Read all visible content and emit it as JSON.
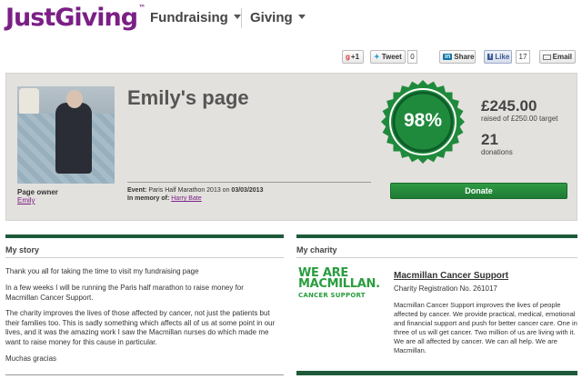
{
  "header": {
    "logo": "JustGiving",
    "logo_tm": "™",
    "nav": [
      {
        "label": "Fundraising"
      },
      {
        "label": "Giving"
      }
    ]
  },
  "share": {
    "gplus_label": "+1",
    "tweet_label": "Tweet",
    "tweet_count": "0",
    "linkedin_label": "Share",
    "fb_label": "Like",
    "fb_count": "17",
    "email_label": "Email"
  },
  "summary": {
    "title": "Emily's page",
    "owner_label": "Page owner",
    "owner_name": "Emily",
    "event_prefix": "Event:",
    "event_text": "Paris Half Marathon 2013 on",
    "event_date": "03/03/2013",
    "memory_prefix": "In memory of:",
    "memory_name": "Harry Bate",
    "percent": "98%",
    "percent_value": 98,
    "amount_raised": "£245.00",
    "target_text": "raised of £250.00 target",
    "donations_count": "21",
    "donations_label": "donations",
    "donate_label": "Donate"
  },
  "story": {
    "heading": "My story",
    "paragraphs": [
      "Thank you all for taking the time to visit my fundraising page",
      "In a few weeks I will be running the Paris half marathon to raise money for Macmillan Cancer Support.",
      "The charity improves the lives of those affected by cancer, not just the patients but their families too. This is sadly something which affects all of us at some point in our lives, and it was the amazing work I saw the Macmillan nurses do which made me want to raise money for this cause in particular.",
      "Muchas gracias"
    ]
  },
  "charity": {
    "heading": "My charity",
    "logo_line1": "WE ARE",
    "logo_line2": "MACMILLAN.",
    "logo_line3": "CANCER SUPPORT",
    "name": "Macmillan Cancer Support",
    "registration": "Charity Registration No. 261017",
    "description": "Macmillan Cancer Support improves the lives of people affected by cancer. We provide practical, medical, emotional and financial support and push for better cancer care. One in three of us will get cancer. Two million of us are living with it. We are all affected by cancer. We can all help. We are Macmillan."
  },
  "colors": {
    "brand_purple": "#7b1f86",
    "green_dark": "#1e5a3a",
    "green_button": "#2f9a44",
    "progress_green": "#1f8a3c"
  }
}
